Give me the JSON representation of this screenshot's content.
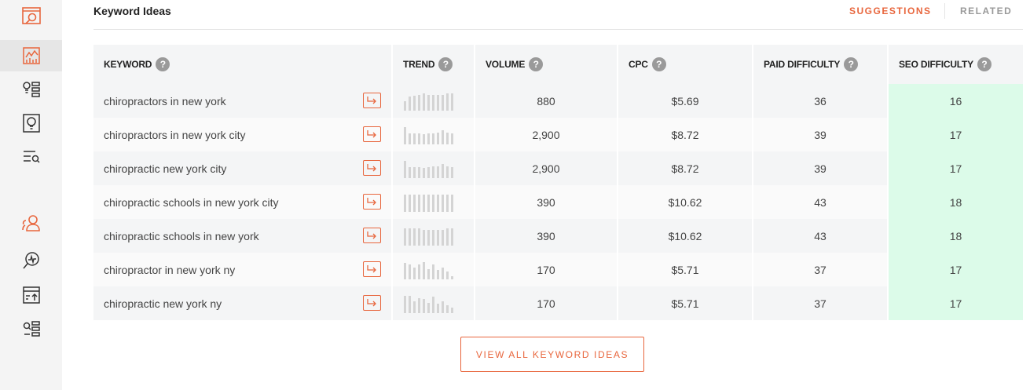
{
  "header": {
    "title": "Keyword Ideas",
    "tab_suggestions": "SUGGESTIONS",
    "tab_related": "RELATED"
  },
  "colors": {
    "accent": "#e8663d",
    "seo_highlight": "#dcfbe9",
    "row_alt": "#f4f5f6"
  },
  "sidebar": {
    "icons": [
      "site-audit-icon",
      "chart-icon",
      "keyword-list-icon",
      "lightbulb-icon",
      "search-list-icon",
      "users-icon",
      "analytics-search-icon",
      "export-icon",
      "list-search-icon"
    ],
    "active_index": 1
  },
  "table": {
    "headers": {
      "keyword": "KEYWORD",
      "trend": "TREND",
      "volume": "VOLUME",
      "cpc": "CPC",
      "paid": "PAID DIFFICULTY",
      "seo": "SEO DIFFICULTY"
    },
    "help_glyph": "?",
    "rows": [
      {
        "keyword": "chiropractors in new york",
        "volume": "880",
        "cpc": "$5.69",
        "paid": "36",
        "seo": "16",
        "trend": [
          0.55,
          0.8,
          0.85,
          0.9,
          1,
          0.9,
          0.9,
          0.9,
          0.9,
          1,
          1
        ]
      },
      {
        "keyword": "chiropractors in new york city",
        "volume": "2,900",
        "cpc": "$8.72",
        "paid": "39",
        "seo": "17",
        "trend": [
          1,
          0.65,
          0.65,
          0.65,
          0.6,
          0.65,
          0.65,
          0.7,
          0.8,
          0.7,
          0.65
        ]
      },
      {
        "keyword": "chiropractic new york city",
        "volume": "2,900",
        "cpc": "$8.72",
        "paid": "39",
        "seo": "17",
        "trend": [
          1,
          0.65,
          0.65,
          0.65,
          0.6,
          0.65,
          0.7,
          0.7,
          0.8,
          0.7,
          0.65
        ]
      },
      {
        "keyword": "chiropractic schools in new york city",
        "volume": "390",
        "cpc": "$10.62",
        "paid": "43",
        "seo": "18",
        "trend": [
          1,
          1,
          1,
          1,
          1,
          1,
          1,
          1,
          1,
          1,
          1
        ]
      },
      {
        "keyword": "chiropractic schools in new york",
        "volume": "390",
        "cpc": "$10.62",
        "paid": "43",
        "seo": "18",
        "trend": [
          1,
          1,
          1,
          1,
          0.9,
          0.9,
          0.9,
          0.9,
          0.9,
          1,
          1
        ]
      },
      {
        "keyword": "chiropractor in new york ny",
        "volume": "170",
        "cpc": "$5.71",
        "paid": "37",
        "seo": "17",
        "trend": [
          0.95,
          0.85,
          0.7,
          0.85,
          1,
          0.6,
          0.85,
          0.55,
          0.7,
          0.45,
          0.2
        ]
      },
      {
        "keyword": "chiropractic new york ny",
        "volume": "170",
        "cpc": "$5.71",
        "paid": "37",
        "seo": "17",
        "trend": [
          1,
          1,
          0.7,
          0.85,
          0.8,
          0.6,
          0.95,
          0.55,
          0.7,
          0.45,
          0.3
        ]
      }
    ]
  },
  "view_all_label": "VIEW ALL KEYWORD IDEAS"
}
